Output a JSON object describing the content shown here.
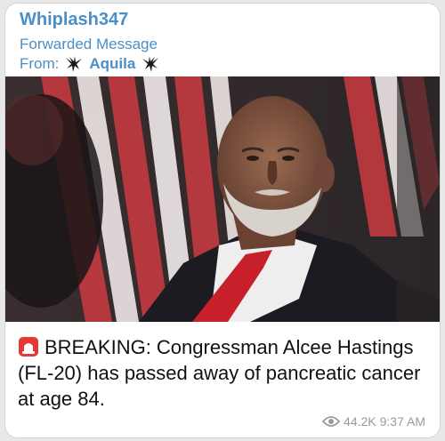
{
  "message": {
    "channel_name": "Whiplash347",
    "forwarded_label": "Forwarded Message",
    "from_prefix": "From:",
    "from_name": "Aquila",
    "caption_prefix_icon": "rotating-light-icon",
    "caption": "BREAKING: Congressman Alcee Hastings (FL-20) has passed away of pancreatic cancer at age 84.",
    "views": "44.2K",
    "time": "9:37 AM"
  },
  "colors": {
    "accent": "#4a8fc7",
    "bubble_bg": "#ffffff",
    "meta_text": "#9a9a9a",
    "alarm_red": "#e23a32"
  },
  "icons": {
    "from_left": "eagle-icon",
    "from_right": "eagle-icon",
    "views": "eye-icon"
  }
}
